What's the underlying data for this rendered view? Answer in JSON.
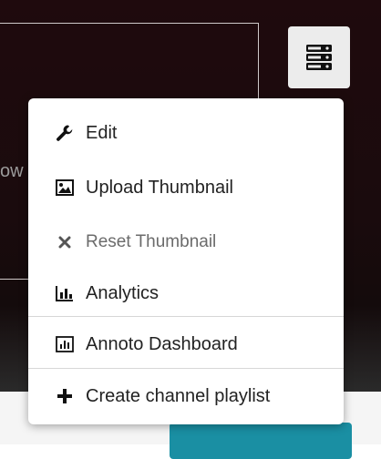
{
  "background": {
    "partial_text": "ow"
  },
  "menu_toggle": {
    "icon": "server-icon"
  },
  "dropdown": {
    "items": [
      {
        "label": "Edit",
        "icon": "wrench-icon",
        "enabled": true
      },
      {
        "label": "Upload Thumbnail",
        "icon": "image-icon",
        "enabled": true
      },
      {
        "label": "Reset Thumbnail",
        "icon": "close-icon",
        "enabled": false
      },
      {
        "label": "Analytics",
        "icon": "bar-chart-icon",
        "enabled": true
      },
      {
        "label": "Annoto Dashboard",
        "icon": "chart-box-icon",
        "enabled": true
      },
      {
        "label": "Create channel playlist",
        "icon": "plus-icon",
        "enabled": true
      }
    ]
  },
  "colors": {
    "accent": "#1a8fa3",
    "menu_text": "#222222",
    "disabled_text": "#6b6b6b"
  }
}
